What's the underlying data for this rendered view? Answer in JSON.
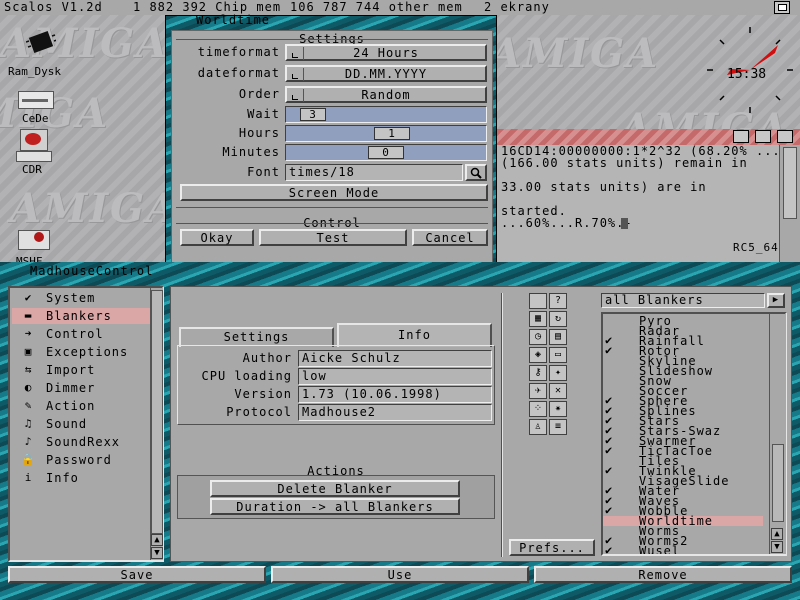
{
  "screen_title": {
    "app": "Scalos V1.2d",
    "chip": "1 882 392 Chip mem",
    "other": "106 787 744 other mem",
    "screens": "2 ekrany"
  },
  "desktop": {
    "watermark": "AMIGA",
    "icons": [
      {
        "label": "Ram_Dysk",
        "icon": "ram-disk-icon"
      },
      {
        "label": "CeDe",
        "icon": "cd-drive-icon"
      },
      {
        "label": "CDR",
        "icon": "cdr-drive-icon"
      },
      {
        "label": "MSHF",
        "icon": "mshf-drive-icon"
      }
    ],
    "clock_time": "15:38"
  },
  "worldtime": {
    "title": "Worldtime",
    "settings_title": "Settings",
    "timeformat_label": "timeformat",
    "timeformat_value": "24 Hours",
    "dateformat_label": "dateformat",
    "dateformat_value": "DD.MM.YYYY",
    "order_label": "Order",
    "order_value": "Random",
    "wait_label": "Wait",
    "wait_value": "3",
    "hours_label": "Hours",
    "hours_value": "1",
    "minutes_label": "Minutes",
    "minutes_value": "0",
    "font_label": "Font",
    "font_value": "times/18",
    "screen_mode": "Screen Mode",
    "control_title": "Control",
    "okay": "Okay",
    "test": "Test",
    "cancel": "Cancel"
  },
  "shell": {
    "lines": [
      "16CD14:00000000:1*2^32 (68.20% ...",
      "(166.00 stats units) remain in",
      "",
      "33.00 stats units) are in",
      "",
      "started.",
      "...60%...R.70%.-"
    ],
    "footer": "RC5_64"
  },
  "madhouse": {
    "title": "MadhouseControl",
    "nav": [
      {
        "label": "System",
        "icon": "check-icon"
      },
      {
        "label": "Blankers",
        "icon": "monitor-icon"
      },
      {
        "label": "Control",
        "icon": "arrow-icon"
      },
      {
        "label": "Exceptions",
        "icon": "screens-icon"
      },
      {
        "label": "Import",
        "icon": "import-icon"
      },
      {
        "label": "Dimmer",
        "icon": "dimmer-icon"
      },
      {
        "label": "Action",
        "icon": "action-icon"
      },
      {
        "label": "Sound",
        "icon": "sound-icon"
      },
      {
        "label": "SoundRexx",
        "icon": "soundrexx-icon"
      },
      {
        "label": "Password",
        "icon": "lock-icon"
      },
      {
        "label": "Info",
        "icon": "info-icon"
      }
    ],
    "tabs": {
      "settings": "Settings",
      "info": "Info"
    },
    "info": {
      "author_label": "Author",
      "author": "Aicke Schulz",
      "cpu_label": "CPU loading",
      "cpu": "low",
      "version_label": "Version",
      "version": "1.73 (10.06.1998)",
      "protocol_label": "Protocol",
      "protocol": "Madhouse2"
    },
    "actions_title": "Actions",
    "delete_blanker": "Delete Blanker",
    "duration_all": "Duration -> all Blankers",
    "prefs": "Prefs...",
    "filter": "all Blankers",
    "blankers": [
      {
        "name": "Pyro",
        "checked": false
      },
      {
        "name": "Radar",
        "checked": false
      },
      {
        "name": "Rainfall",
        "checked": true
      },
      {
        "name": "Rotor",
        "checked": true
      },
      {
        "name": "Skyline",
        "checked": false
      },
      {
        "name": "Slideshow",
        "checked": false
      },
      {
        "name": "Snow",
        "checked": false
      },
      {
        "name": "Soccer",
        "checked": false
      },
      {
        "name": "Sphere",
        "checked": true
      },
      {
        "name": "Splines",
        "checked": true
      },
      {
        "name": "Stars",
        "checked": true
      },
      {
        "name": "Stars-Swaz",
        "checked": true
      },
      {
        "name": "Swarmer",
        "checked": true
      },
      {
        "name": "TicTacToe",
        "checked": true
      },
      {
        "name": "Tiles",
        "checked": false
      },
      {
        "name": "Twinkle",
        "checked": true
      },
      {
        "name": "VisageSlide",
        "checked": false
      },
      {
        "name": "Water",
        "checked": true
      },
      {
        "name": "Waves",
        "checked": true
      },
      {
        "name": "Wobble",
        "checked": true
      },
      {
        "name": "Worldtime",
        "checked": false,
        "selected": true
      },
      {
        "name": "Worms",
        "checked": false
      },
      {
        "name": "Worms2",
        "checked": true
      },
      {
        "name": "Wusel",
        "checked": true
      }
    ],
    "save": "Save",
    "use": "Use",
    "remove": "Remove"
  }
}
